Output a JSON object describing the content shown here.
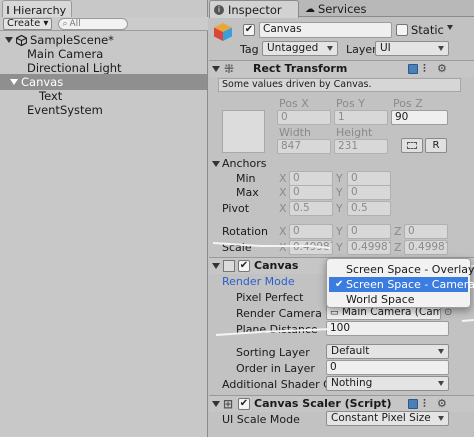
{
  "hierarchy": {
    "tab_label": "Hierarchy",
    "create_label": "Create ▾",
    "search_placeholder": "All",
    "items": [
      {
        "label": "SampleScene*"
      },
      {
        "label": "Main Camera"
      },
      {
        "label": "Directional Light"
      },
      {
        "label": "Canvas"
      },
      {
        "label": "Text"
      },
      {
        "label": "EventSystem"
      }
    ]
  },
  "inspector": {
    "tabs": [
      "Inspector",
      "Services"
    ],
    "object": {
      "name": "Canvas",
      "static_label": "Static",
      "tag_label": "Tag",
      "tag_value": "Untagged",
      "layer_label": "Layer",
      "layer_value": "UI"
    },
    "rect_transform": {
      "title": "Rect Transform",
      "note": "Some values driven by Canvas.",
      "pos_x_label": "Pos X",
      "pos_y_label": "Pos Y",
      "pos_z_label": "Pos Z",
      "pos_x": "0",
      "pos_y": "1",
      "pos_z": "90",
      "width_label": "Width",
      "height_label": "Height",
      "width": "847",
      "height": "231",
      "r_button": "R",
      "anchors_label": "Anchors",
      "min_label": "Min",
      "max_label": "Max",
      "min_x": "0",
      "min_y": "0",
      "max_x": "0",
      "max_y": "0",
      "pivot_label": "Pivot",
      "pivot_x": "0.5",
      "pivot_y": "0.5",
      "rotation_label": "Rotation",
      "rot_x": "0",
      "rot_y": "0",
      "rot_z": "0",
      "scale_label": "Scale",
      "scale_x": "0.49987",
      "scale_y": "0.49987",
      "scale_z": "0.49987",
      "x_lbl": "X",
      "y_lbl": "Y",
      "z_lbl": "Z"
    },
    "canvas": {
      "title": "Canvas",
      "render_mode_label": "Render Mode",
      "pixel_perfect_label": "Pixel Perfect",
      "render_camera_label": "Render Camera",
      "render_camera_value": "Main Camera (Cam",
      "plane_distance_label": "Plane Distance",
      "plane_distance_value": "100",
      "sorting_layer_label": "Sorting Layer",
      "sorting_layer_value": "Default",
      "order_in_layer_label": "Order in Layer",
      "order_in_layer_value": "0",
      "additional_shader_label": "Additional Shader Cha",
      "additional_shader_value": "Nothing"
    },
    "canvas_scaler": {
      "title": "Canvas Scaler (Script)",
      "ui_scale_mode_label": "UI Scale Mode",
      "ui_scale_mode_value": "Constant Pixel Size"
    }
  },
  "render_mode_popup": {
    "options": [
      "Screen Space - Overlay",
      "Screen Space - Camera",
      "World Space"
    ],
    "selected": "Screen Space - Camera"
  },
  "colors": {
    "selection_blue": "#3a7ce0",
    "render_mode_label": "#2c5fcc",
    "hierarchy_selected": "#8f8f8f"
  }
}
